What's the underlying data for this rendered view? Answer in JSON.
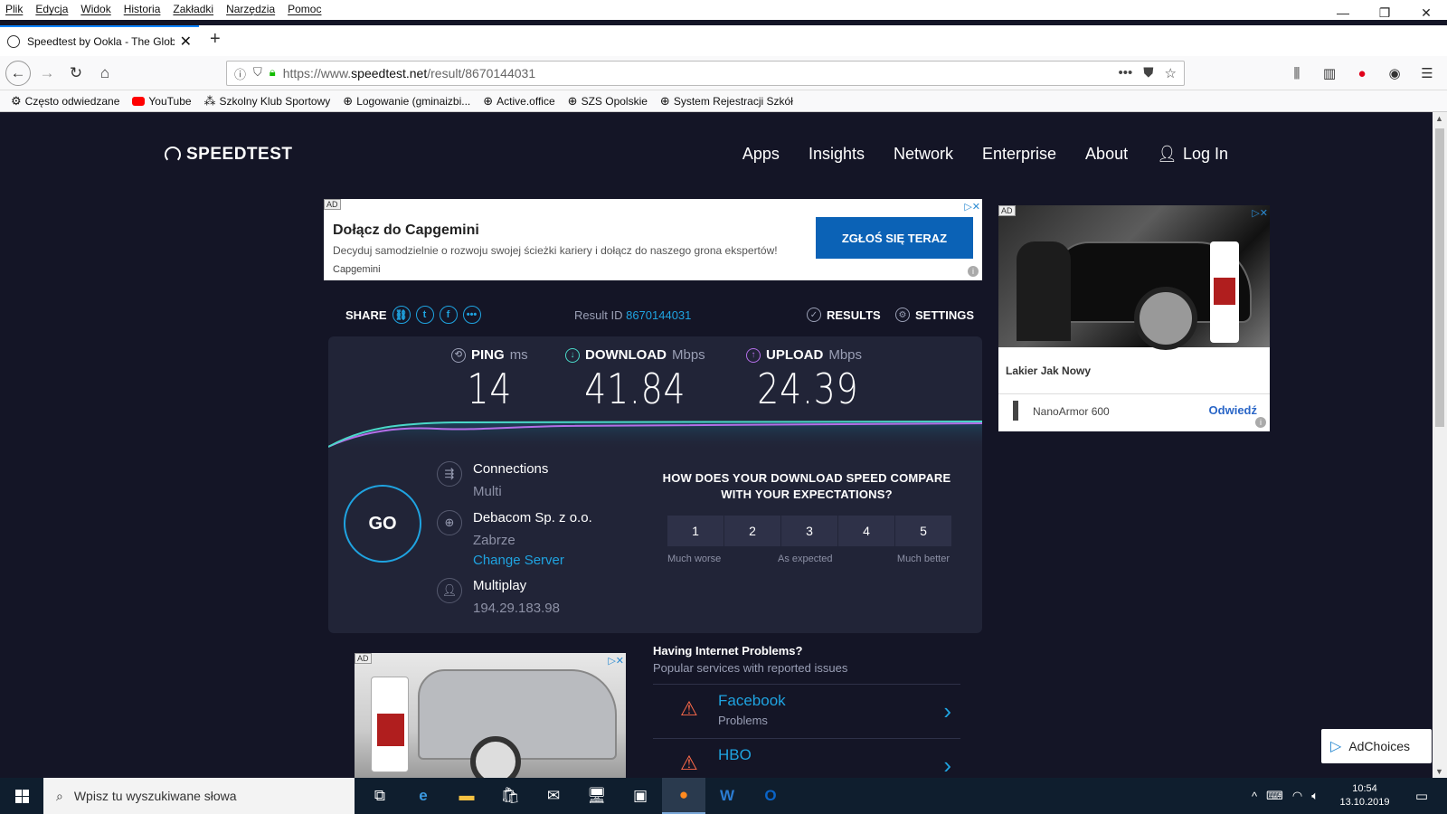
{
  "browser": {
    "menu": [
      "Plik",
      "Edycja",
      "Widok",
      "Historia",
      "Zakładki",
      "Narzędzia",
      "Pomoc"
    ],
    "tab_title": "Speedtest by Ookla - The Globa",
    "url_prefix": "https://www.",
    "url_host": "speedtest.net",
    "url_path": "/result/8670144031",
    "bookmarks": [
      "Często odwiedzane",
      "YouTube",
      "Szkolny Klub Sportowy",
      "Logowanie (gminaizbi...",
      "Active.office",
      "SZS Opolskie",
      "System Rejestracji Szkół"
    ]
  },
  "site": {
    "logo": "SPEEDTEST",
    "nav": [
      "Apps",
      "Insights",
      "Network",
      "Enterprise",
      "About"
    ],
    "login": "Log In"
  },
  "ads": {
    "banner": {
      "tag": "AD",
      "title": "Dołącz do Capgemini",
      "desc": "Decyduj samodzielnie o rozwoju swojej ścieżki kariery i dołącz do naszego grona ekspertów!",
      "brand": "Capgemini",
      "cta": "ZGŁOŚ SIĘ TERAZ"
    },
    "side": {
      "tag": "AD",
      "headline": "Lakier Jak Nowy",
      "product": "NanoArmor 600",
      "visit": "Odwiedź"
    },
    "bottom_tag": "AD",
    "adchoices": "AdChoices"
  },
  "result": {
    "share_label": "SHARE",
    "result_id_label": "Result ID",
    "result_id": "8670144031",
    "results_label": "RESULTS",
    "settings_label": "SETTINGS"
  },
  "metrics": {
    "ping": {
      "label": "PING",
      "unit": "ms",
      "value": "14"
    },
    "download": {
      "label": "DOWNLOAD",
      "unit": "Mbps",
      "value": "41.84"
    },
    "upload": {
      "label": "UPLOAD",
      "unit": "Mbps",
      "value": "24.39"
    }
  },
  "test": {
    "go": "GO",
    "connections_title": "Connections",
    "connections_value": "Multi",
    "server_name": "Debacom Sp. z o.o.",
    "server_city": "Zabrze",
    "change_server": "Change Server",
    "isp_name": "Multiplay",
    "isp_ip": "194.29.183.98"
  },
  "survey": {
    "question": "HOW DOES YOUR DOWNLOAD SPEED COMPARE WITH YOUR EXPECTATIONS?",
    "options": [
      "1",
      "2",
      "3",
      "4",
      "5"
    ],
    "low_label": "Much worse",
    "mid_label": "As expected",
    "high_label": "Much better"
  },
  "problems": {
    "title": "Having Internet Problems?",
    "subtitle": "Popular services with reported issues",
    "items": [
      {
        "name": "Facebook",
        "desc": "Problems"
      },
      {
        "name": "HBO",
        "desc": ""
      }
    ]
  },
  "taskbar": {
    "search_placeholder": "Wpisz tu wyszukiwane słowa",
    "time": "10:54",
    "date": "13.10.2019"
  },
  "colors": {
    "page_bg": "#141526",
    "panel_bg": "#212437",
    "accent": "#1fa3e0",
    "download": "#4ad8c8",
    "upload": "#b46ee8"
  }
}
